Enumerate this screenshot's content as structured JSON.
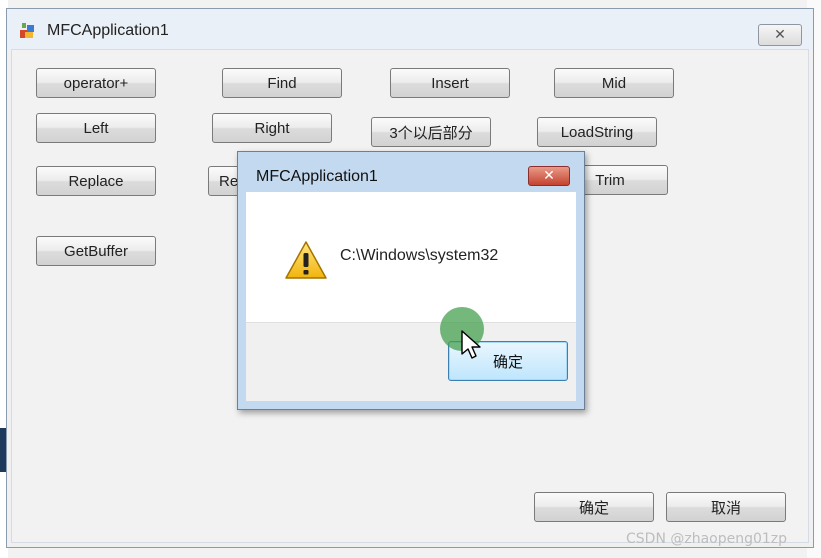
{
  "window": {
    "title": "MFCApplication1",
    "close_glyph": "✕"
  },
  "buttons": {
    "operator_plus": "operator+",
    "find": "Find",
    "insert": "Insert",
    "mid": "Mid",
    "left": "Left",
    "right": "Right",
    "after_three": "3个以后部分",
    "loadstring": "LoadString",
    "replace": "Replace",
    "re_partial": "Re",
    "trim": "Trim",
    "getbuffer": "GetBuffer",
    "ok": "确定",
    "cancel": "取消"
  },
  "message_box": {
    "title": "MFCApplication1",
    "close_glyph": "✕",
    "message": "C:\\Windows\\system32",
    "ok_label": "确定",
    "icon": "warning-icon"
  },
  "watermark": "CSDN @zhaopeng01zp",
  "colors": {
    "title_bar": "#eaf0f7",
    "dialog_frame": "#c3d9ef",
    "close_red": "#c4432f",
    "ok_focus": "#bee6fd"
  }
}
